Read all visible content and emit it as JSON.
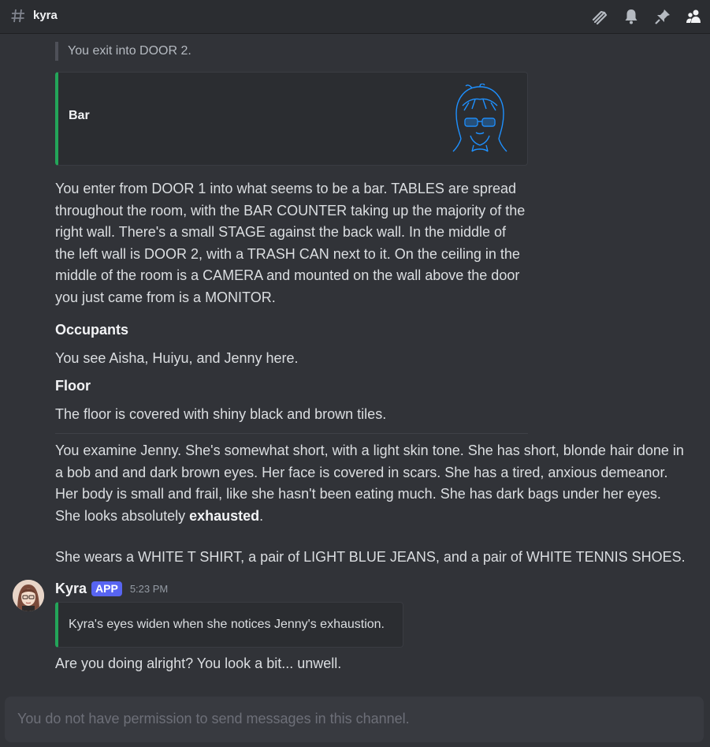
{
  "header": {
    "channel_name": "kyra",
    "icons": [
      "hash-icon",
      "threads-icon",
      "bell-icon",
      "pin-icon",
      "members-icon"
    ]
  },
  "messages": {
    "quote": "You exit into DOOR 2.",
    "embed": {
      "title": "Bar",
      "accent_color": "#23a559"
    },
    "description": "You enter from DOOR 1 into what seems to be a bar. TABLES are spread throughout the room, with the BAR COUNTER taking up the majority of the right wall. There's a small STAGE against the back wall. In the middle of the left wall is DOOR 2, with a TRASH CAN next to it. On the ceiling in the middle of the room is a CAMERA and mounted on the wall above the door you just came from is a MONITOR.",
    "occupants_heading": "Occupants",
    "occupants_text": "You see Aisha, Huiyu, and Jenny here.",
    "floor_heading": "Floor",
    "floor_text": "The floor is covered with shiny black and brown tiles.",
    "examine_before": "You examine Jenny. She's somewhat short, with a light skin tone. She has short, blonde hair done in a bob and and dark brown eyes. Her face is covered in scars. She has a tired, anxious demeanor. Her body is small and frail, like she hasn't been eating much. She has dark bags under her eyes. She looks absolutely ",
    "examine_bold": "exhausted",
    "examine_after": ".",
    "wears": "She wears a WHITE T SHIRT, a pair of LIGHT BLUE JEANS, and a pair of WHITE TENNIS SHOES."
  },
  "kyra_message": {
    "author": "Kyra",
    "badge": "APP",
    "timestamp": "5:23 PM",
    "embed_text": "Kyra's eyes widen when she notices Jenny's exhaustion.",
    "reply": "Are you doing alright? You look a bit... unwell."
  },
  "composer": {
    "placeholder": "You do not have permission to send messages in this channel."
  }
}
